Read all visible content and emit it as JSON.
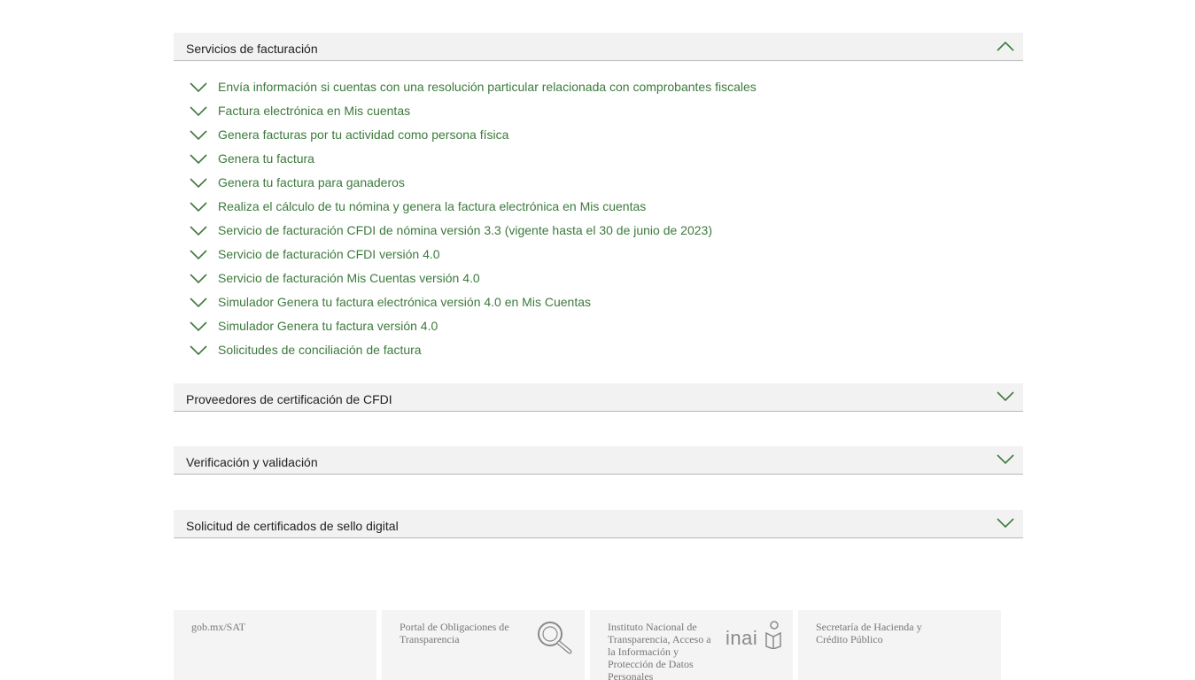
{
  "colors": {
    "accent": "#3c7a3c",
    "header_bg": "#f2f2f2",
    "footer_bg": "#f4f4f4",
    "footer_text": "#777777"
  },
  "sections": [
    {
      "title": "Servicios de facturación",
      "expanded": true,
      "icon": "chevron-up-icon"
    },
    {
      "title": "Proveedores de certificación de CFDI",
      "expanded": false,
      "icon": "chevron-down-icon"
    },
    {
      "title": "Verificación y validación",
      "expanded": false,
      "icon": "chevron-down-icon"
    },
    {
      "title": "Solicitud de certificados de sello digital",
      "expanded": false,
      "icon": "chevron-down-icon"
    }
  ],
  "services": [
    "Envía información si cuentas con una resolución particular relacionada con comprobantes fiscales",
    "Factura electrónica en Mis cuentas",
    "Genera facturas por tu actividad como persona física",
    "Genera tu factura",
    "Genera tu factura para ganaderos",
    "Realiza el cálculo de tu nómina y genera la factura electrónica en Mis cuentas",
    "Servicio de facturación CFDI de nómina versión 3.3 (vigente hasta el 30 de junio de 2023)",
    "Servicio de facturación CFDI versión 4.0",
    "Servicio de facturación Mis Cuentas versión 4.0",
    "Simulador Genera tu factura electrónica versión 4.0 en Mis Cuentas",
    "Simulador Genera tu factura versión 4.0",
    "Solicitudes de conciliación de factura"
  ],
  "footer": {
    "gob": "gob.mx/SAT",
    "transparencia": "Portal de Obligaciones de Transparencia",
    "inai_text": "Instituto Nacional de Transparencia, Acceso a la Información y Protección de Datos Personales",
    "inai_logo": "inai",
    "hacienda": "Secretaría de Hacienda y Crédito Público"
  }
}
